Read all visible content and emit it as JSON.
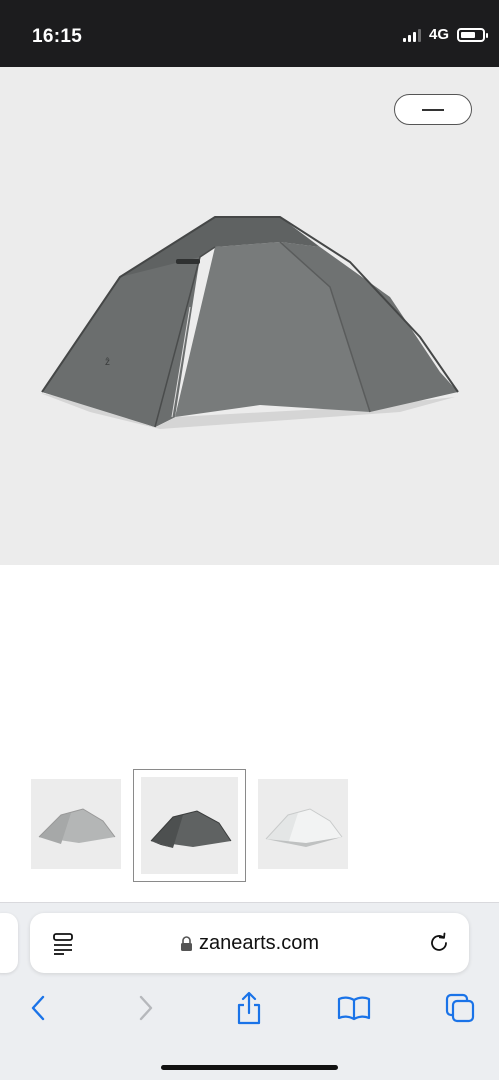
{
  "status_bar": {
    "time": "16:15",
    "network": "4G",
    "signal_bars_filled": 3
  },
  "hero": {
    "image_icon": "tent-icon",
    "tent_color": "#6d7070",
    "background_color": "#ececec",
    "toggle_icon": "minus-icon"
  },
  "thumbnails": [
    {
      "name": "thumb-tent-light-gray",
      "tent_color": "#b4b6b6",
      "selected": false
    },
    {
      "name": "thumb-tent-dark-gray",
      "tent_color": "#5f6262",
      "selected": true
    },
    {
      "name": "thumb-tent-white",
      "tent_color": "#eef0f0",
      "selected": false
    }
  ],
  "browser": {
    "url": "zanearts.com",
    "reader_icon": "reader-mode-icon",
    "lock_icon": "lock-icon",
    "reload_icon": "reload-icon",
    "nav": [
      {
        "name": "back-button",
        "icon": "chevron-left-icon",
        "enabled": true
      },
      {
        "name": "forward-button",
        "icon": "chevron-right-icon",
        "enabled": false
      },
      {
        "name": "share-button",
        "icon": "share-icon",
        "enabled": true
      },
      {
        "name": "bookmarks-button",
        "icon": "book-icon",
        "enabled": true
      },
      {
        "name": "tabs-button",
        "icon": "tabs-icon",
        "enabled": true
      }
    ],
    "accent_color": "#1a73e8"
  }
}
